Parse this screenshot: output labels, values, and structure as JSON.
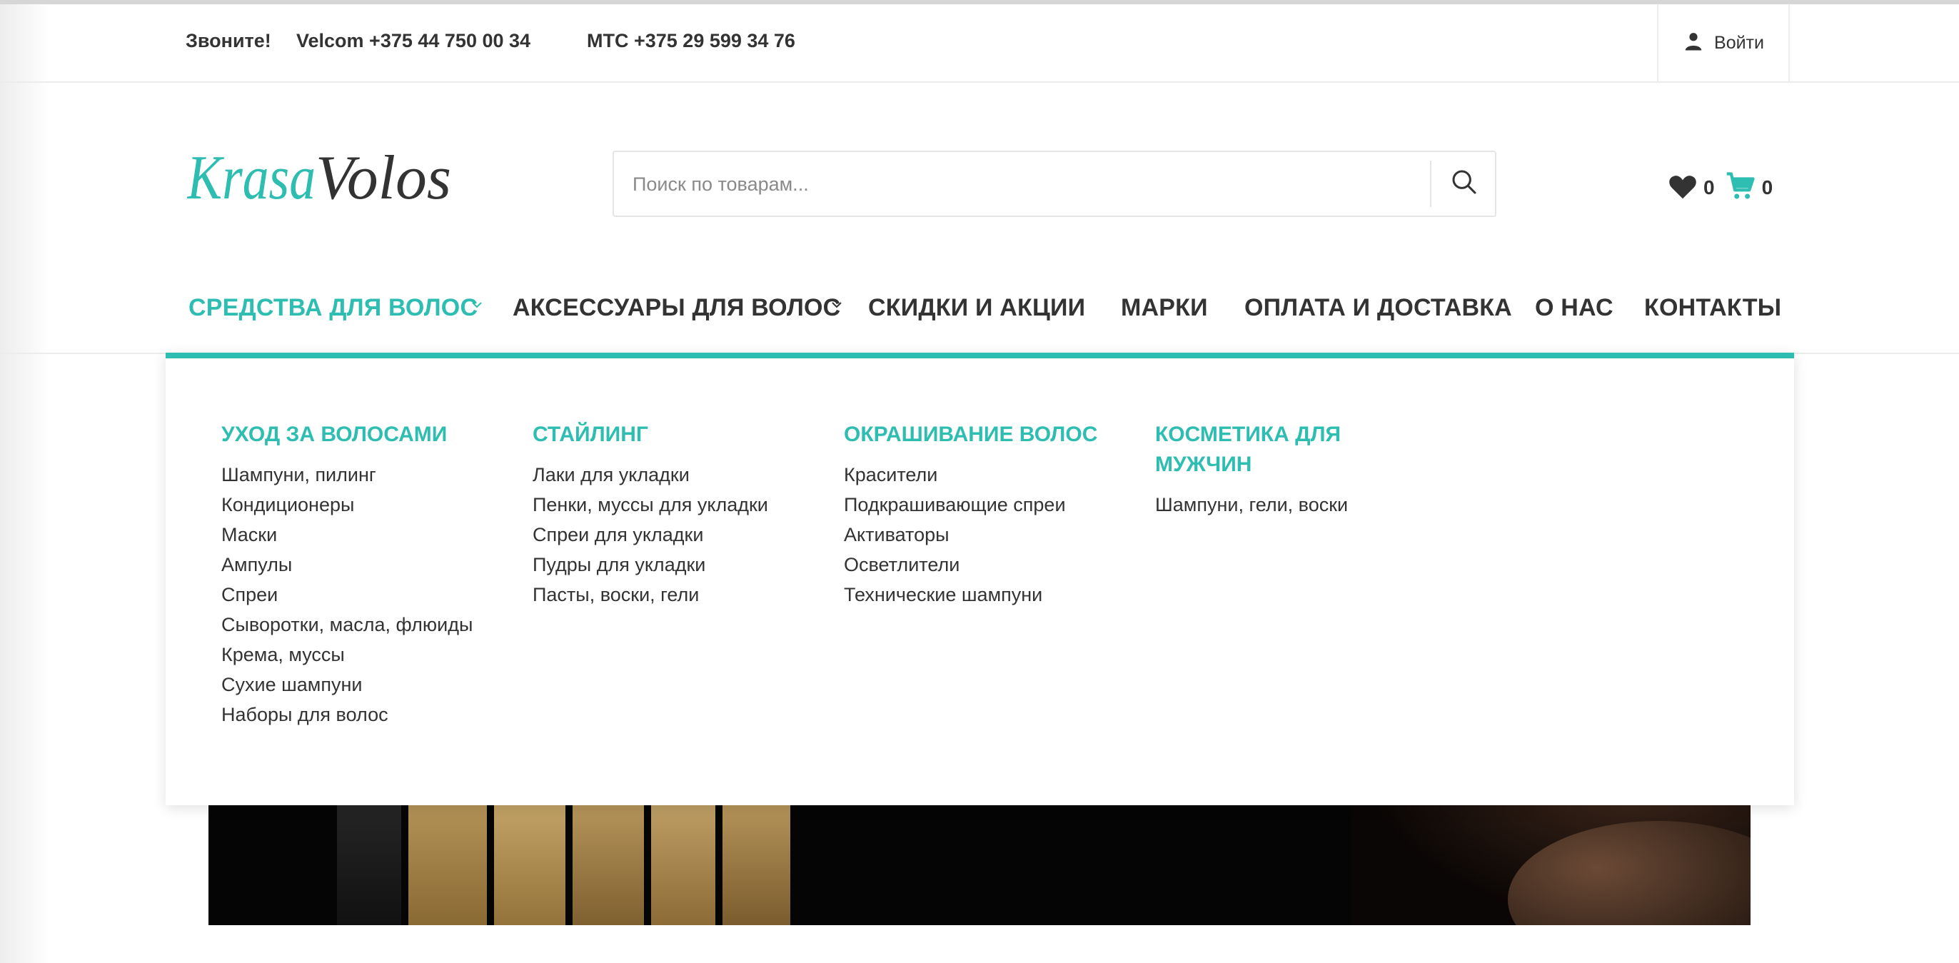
{
  "topbar": {
    "call_label": "Звоните!",
    "phone_velcom": "Velcom +375 44 750 00 34",
    "phone_mts": "МТС +375 29 599 34 76",
    "login_label": "Войти"
  },
  "logo": {
    "text_part1": "Krasa",
    "text_part2": "Volos",
    "color_part1": "#2ebdb1",
    "color_part2": "#333333"
  },
  "search": {
    "placeholder": "Поиск по товарам..."
  },
  "counters": {
    "wishlist": "0",
    "cart": "0"
  },
  "nav": {
    "items": [
      {
        "label": "СРЕДСТВА ДЛЯ ВОЛОС",
        "active": true
      },
      {
        "label": "АКСЕССУАРЫ ДЛЯ ВОЛОС"
      },
      {
        "label": "СКИДКИ И АКЦИИ"
      },
      {
        "label": "МАРКИ"
      },
      {
        "label": "ОПЛАТА И ДОСТАВКА"
      },
      {
        "label": "О НАС"
      },
      {
        "label": "КОНТАКТЫ"
      }
    ]
  },
  "mega_menu": {
    "columns": [
      {
        "title": "УХОД ЗА ВОЛОСАМИ",
        "links": [
          "Шампуни, пилинг",
          "Кондиционеры",
          "Маски",
          "Ампулы",
          "Спреи",
          "Сыворотки, масла, флюиды",
          "Крема, муссы",
          "Сухие шампуни",
          "Наборы для волос"
        ]
      },
      {
        "title": "СТАЙЛИНГ",
        "links": [
          "Лаки для укладки",
          "Пенки, муссы для укладки",
          "Спреи для укладки",
          "Пудры для укладки",
          "Пасты, воски, гели"
        ]
      },
      {
        "title": "ОКРАШИВАНИЕ ВОЛОС",
        "links": [
          "Красители",
          "Подкрашивающие спреи",
          "Активаторы",
          "Осветлители",
          "Технические шампуни"
        ]
      },
      {
        "title": "КОСМЕТИКА ДЛЯ МУЖЧИН",
        "links": [
          "Шампуни, гели, воски"
        ]
      }
    ]
  },
  "colors": {
    "accent": "#2ebdb1",
    "text": "#333333",
    "border": "#ececec"
  }
}
